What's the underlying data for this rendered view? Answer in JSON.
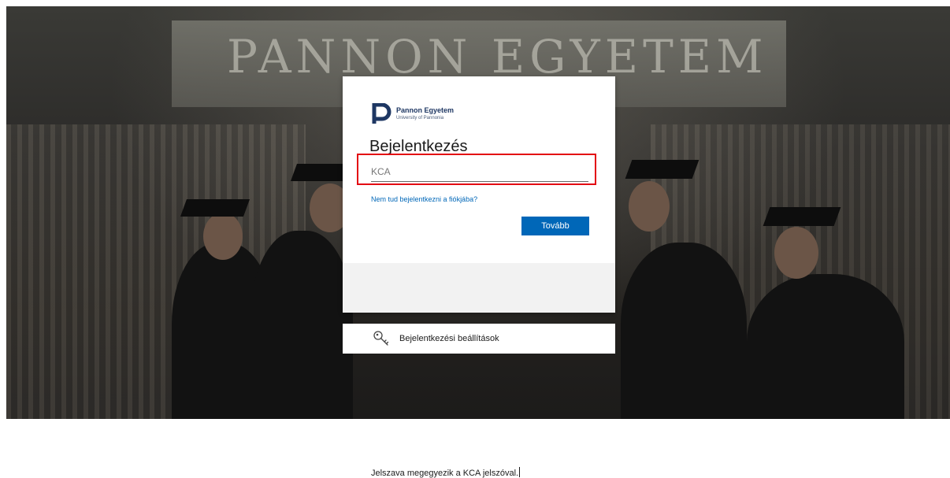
{
  "background": {
    "building_sign": "PANNON EGYETEM"
  },
  "logo": {
    "name": "Pannon Egyetem",
    "subtitle": "University of Pannonia",
    "icon": "pannon-p-logo",
    "color": "#1e3763"
  },
  "signin": {
    "title": "Bejelentkezés",
    "username_value": "",
    "username_placeholder": "KCA",
    "help_link": "Nem tud bejelentkezni a fiókjába?",
    "next_label": "Tovább",
    "notice": "Jelszava megegyezik a KCA jelszóval."
  },
  "options": {
    "label": "Bejelentkezési beállítások",
    "icon": "key-icon"
  },
  "colors": {
    "accent": "#0067b8",
    "highlight": "#e30613"
  }
}
